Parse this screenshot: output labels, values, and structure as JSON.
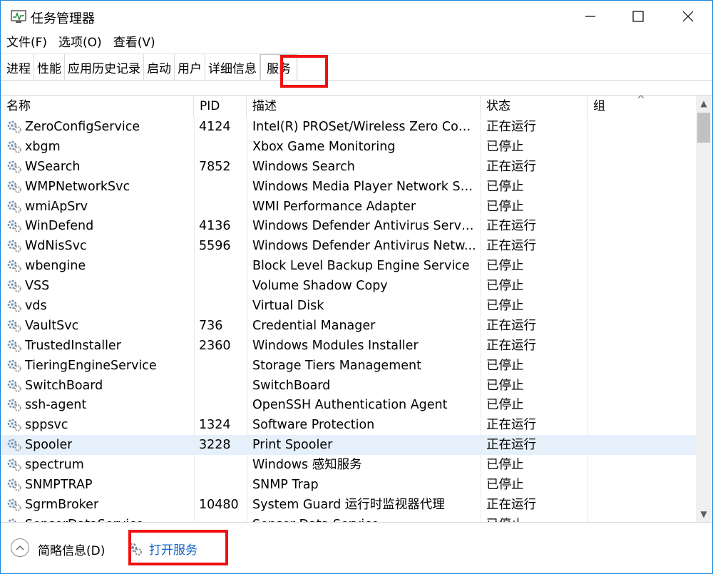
{
  "window": {
    "title": "任务管理器",
    "controls": {
      "minimize": "—",
      "maximize": "☐",
      "close": "✕"
    }
  },
  "menu": [
    "文件(F)",
    "选项(O)",
    "查看(V)"
  ],
  "tabs": [
    "进程",
    "性能",
    "应用历史记录",
    "启动",
    "用户",
    "详细信息",
    "服务"
  ],
  "active_tab": "服务",
  "columns": {
    "name": "名称",
    "pid": "PID",
    "desc": "描述",
    "status": "状态",
    "group": "组"
  },
  "sort_indicator": "^",
  "services": [
    {
      "name": "ZeroConfigService",
      "pid": "4124",
      "desc": "Intel(R) PROSet/Wireless Zero Conf...",
      "status": "正在运行",
      "group": ""
    },
    {
      "name": "xbgm",
      "pid": "",
      "desc": "Xbox Game Monitoring",
      "status": "已停止",
      "group": ""
    },
    {
      "name": "WSearch",
      "pid": "7852",
      "desc": "Windows Search",
      "status": "正在运行",
      "group": ""
    },
    {
      "name": "WMPNetworkSvc",
      "pid": "",
      "desc": "Windows Media Player Network Sh...",
      "status": "已停止",
      "group": ""
    },
    {
      "name": "wmiApSrv",
      "pid": "",
      "desc": "WMI Performance Adapter",
      "status": "已停止",
      "group": ""
    },
    {
      "name": "WinDefend",
      "pid": "4136",
      "desc": "Windows Defender Antivirus Service",
      "status": "正在运行",
      "group": ""
    },
    {
      "name": "WdNisSvc",
      "pid": "5596",
      "desc": "Windows Defender Antivirus Netw...",
      "status": "正在运行",
      "group": ""
    },
    {
      "name": "wbengine",
      "pid": "",
      "desc": "Block Level Backup Engine Service",
      "status": "已停止",
      "group": ""
    },
    {
      "name": "VSS",
      "pid": "",
      "desc": "Volume Shadow Copy",
      "status": "已停止",
      "group": ""
    },
    {
      "name": "vds",
      "pid": "",
      "desc": "Virtual Disk",
      "status": "已停止",
      "group": ""
    },
    {
      "name": "VaultSvc",
      "pid": "736",
      "desc": "Credential Manager",
      "status": "正在运行",
      "group": ""
    },
    {
      "name": "TrustedInstaller",
      "pid": "2360",
      "desc": "Windows Modules Installer",
      "status": "正在运行",
      "group": ""
    },
    {
      "name": "TieringEngineService",
      "pid": "",
      "desc": "Storage Tiers Management",
      "status": "已停止",
      "group": ""
    },
    {
      "name": "SwitchBoard",
      "pid": "",
      "desc": "SwitchBoard",
      "status": "已停止",
      "group": ""
    },
    {
      "name": "ssh-agent",
      "pid": "",
      "desc": "OpenSSH Authentication Agent",
      "status": "已停止",
      "group": ""
    },
    {
      "name": "sppsvc",
      "pid": "1324",
      "desc": "Software Protection",
      "status": "正在运行",
      "group": ""
    },
    {
      "name": "Spooler",
      "pid": "3228",
      "desc": "Print Spooler",
      "status": "正在运行",
      "group": "",
      "selected": true
    },
    {
      "name": "spectrum",
      "pid": "",
      "desc": "Windows 感知服务",
      "status": "已停止",
      "group": ""
    },
    {
      "name": "SNMPTRAP",
      "pid": "",
      "desc": "SNMP Trap",
      "status": "已停止",
      "group": ""
    },
    {
      "name": "SgrmBroker",
      "pid": "10480",
      "desc": "System Guard 运行时监视器代理",
      "status": "正在运行",
      "group": ""
    },
    {
      "name": "SensorDataService",
      "pid": "",
      "desc": "Sensor Data Service",
      "status": "已停止",
      "group": ""
    }
  ],
  "footer": {
    "fewer_details": "简略信息(D)",
    "open_services": "打开服务"
  },
  "colors": {
    "accent": "#1883d7",
    "selected_row": "#e6f0fb",
    "link": "#0f64c8",
    "highlight_box": "#ee1111"
  }
}
